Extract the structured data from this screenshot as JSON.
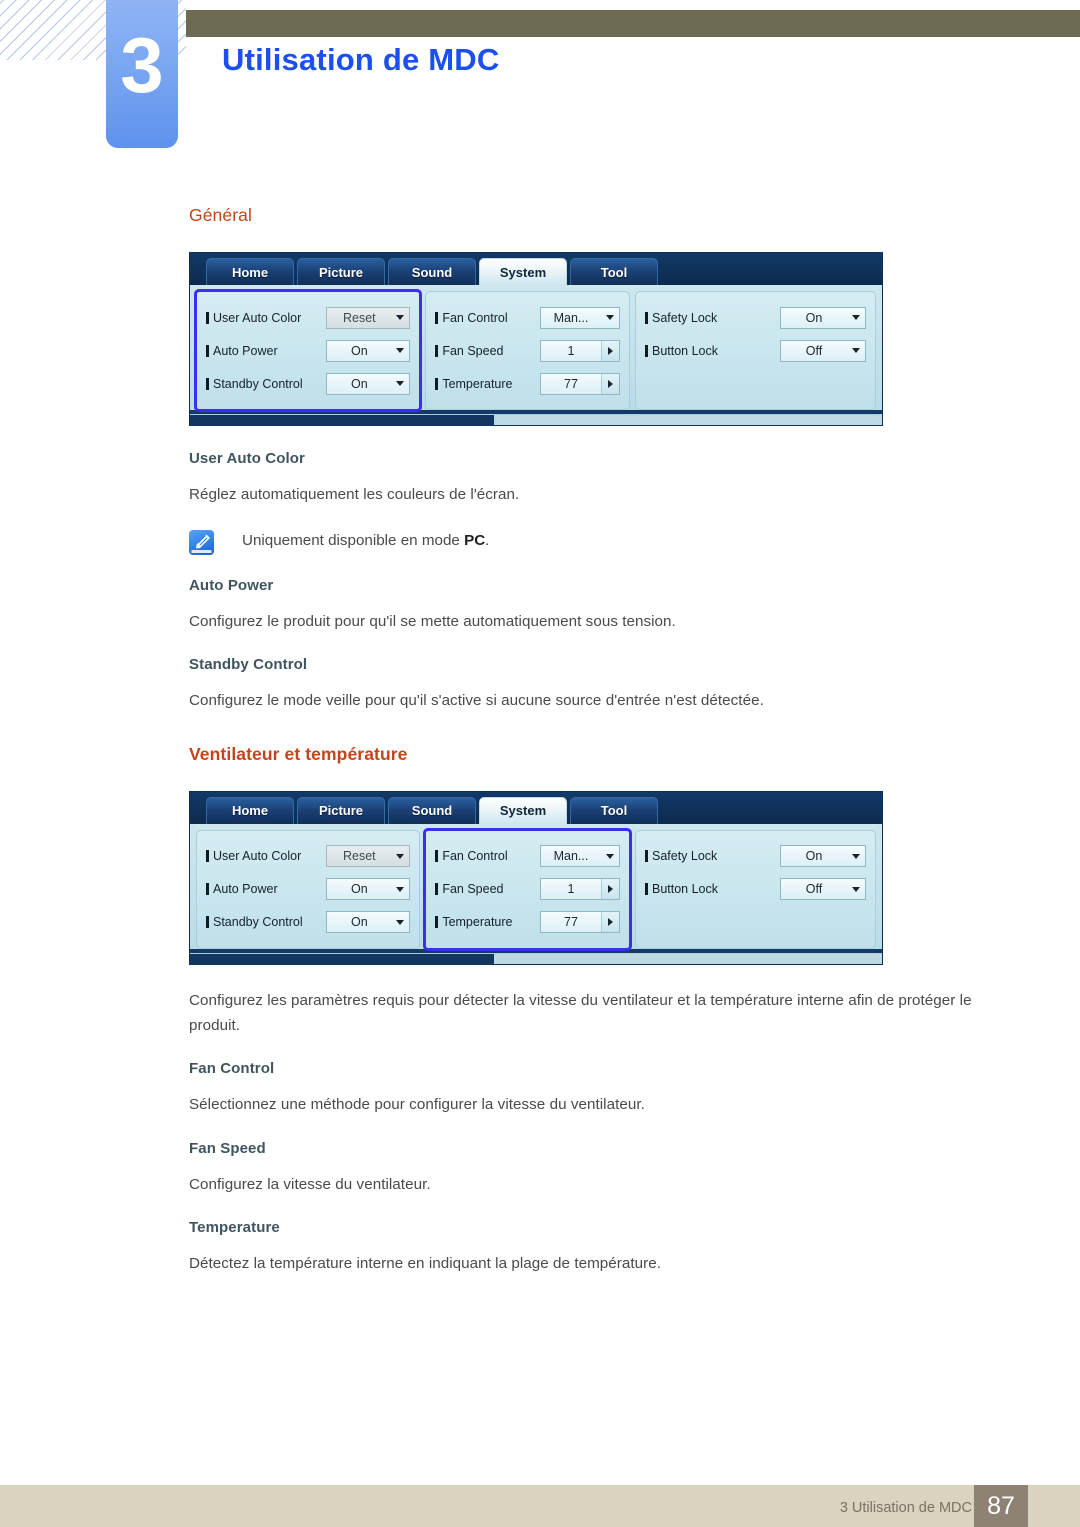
{
  "header": {
    "chapter_number": "3",
    "chapter_title": "Utilisation de MDC",
    "accent_blue": "#1b4ff0",
    "olive": "#6d6a53"
  },
  "sections": {
    "general_heading": "Général",
    "fan_heading": "Ventilateur et température",
    "heading_color": "#c8431b",
    "subheading_color": "#3f5560"
  },
  "mdc": {
    "tabs": [
      {
        "label": "Home",
        "active": false
      },
      {
        "label": "Picture",
        "active": false
      },
      {
        "label": "Sound",
        "active": false
      },
      {
        "label": "System",
        "active": true
      },
      {
        "label": "Tool",
        "active": false
      }
    ],
    "group1": {
      "rows": [
        {
          "label": "User Auto Color",
          "value": "Reset",
          "control": "dropdown",
          "disabled": true
        },
        {
          "label": "Auto Power",
          "value": "On",
          "control": "dropdown",
          "disabled": false
        },
        {
          "label": "Standby Control",
          "value": "On",
          "control": "dropdown",
          "disabled": false
        }
      ]
    },
    "group2": {
      "rows": [
        {
          "label": "Fan Control",
          "value": "Man...",
          "control": "dropdown",
          "disabled": false
        },
        {
          "label": "Fan Speed",
          "value": "1",
          "control": "spinner",
          "disabled": false
        },
        {
          "label": "Temperature",
          "value": "77",
          "control": "spinner",
          "disabled": false
        }
      ]
    },
    "group3": {
      "rows": [
        {
          "label": "Safety Lock",
          "value": "On",
          "control": "dropdown",
          "disabled": false
        },
        {
          "label": "Button Lock",
          "value": "Off",
          "control": "dropdown",
          "disabled": false
        }
      ]
    },
    "highlight_color": "#3a2ef0",
    "highlight_first": "group1",
    "highlight_second": "group2"
  },
  "body": {
    "user_auto_color_title": "User Auto Color",
    "user_auto_color_text": "Réglez automatiquement les couleurs de l'écran.",
    "note_prefix": "Uniquement disponible en mode ",
    "note_bold": "PC",
    "note_suffix": ".",
    "auto_power_title": "Auto Power",
    "auto_power_text": "Configurez le produit pour qu'il se mette automatiquement sous tension.",
    "standby_control_title": "Standby Control",
    "standby_control_text": "Configurez le mode veille pour qu'il s'active si aucune source d'entrée n'est détectée.",
    "fan_intro_text": "Configurez les paramètres requis pour détecter la vitesse du ventilateur et la température interne afin de protéger le produit.",
    "fan_control_title": "Fan Control",
    "fan_control_text": "Sélectionnez une méthode pour configurer la vitesse du ventilateur.",
    "fan_speed_title": "Fan Speed",
    "fan_speed_text": "Configurez la vitesse du ventilateur.",
    "temperature_title": "Temperature",
    "temperature_text": "Détectez la température interne en indiquant la plage de température."
  },
  "footer": {
    "text": "3 Utilisation de MDC",
    "page_number": "87",
    "bar_color": "#d9d3c0",
    "page_box_color": "#8d8274"
  }
}
